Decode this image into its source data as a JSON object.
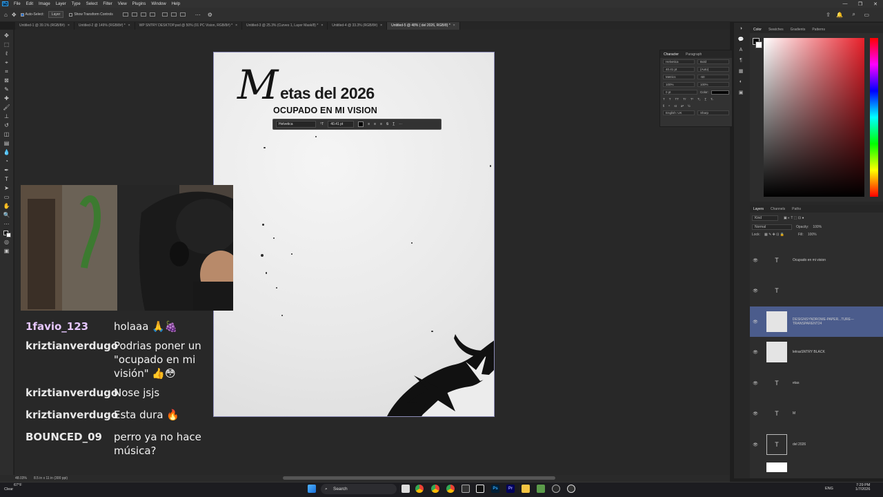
{
  "menubar": {
    "items": [
      "File",
      "Edit",
      "Image",
      "Layer",
      "Type",
      "Select",
      "Filter",
      "View",
      "Plugins",
      "Window",
      "Help"
    ]
  },
  "options_bar": {
    "auto_select_label": "Auto-Select:",
    "auto_select_value": "Layer",
    "show_transform_label": "Show Transform Controls"
  },
  "tabs": [
    {
      "label": "Untitled-1 @ 39.1% (RGB/8#)"
    },
    {
      "label": "Untitled-2 @ 149% (RGB/8#) *"
    },
    {
      "label": "WP SNTRY DESKTOP.psd @ 50% (01 PC Vision, RGB/8#) *"
    },
    {
      "label": "Untitled-3 @ 25.3% (Curves 1, Layer Mask/8) *"
    },
    {
      "label": "Untitled-4 @ 33.3% (RGB/8#)"
    },
    {
      "label": "Untitled-5 @ 48% ( del 2026, RGB/8) *"
    }
  ],
  "document": {
    "title_script": "M",
    "title_rest": "etas del 2026",
    "subtitle": "OCUPADO EN MI VISION"
  },
  "context_bar": {
    "font": "Helvetica",
    "size": "40.41 pt"
  },
  "character_panel": {
    "tabs": [
      "Character",
      "Paragraph"
    ],
    "font_family": "Helvetica",
    "font_style": "Bold",
    "size": "40.41 pt",
    "leading": "(Auto)",
    "kerning": "Metrics",
    "tracking": "-60",
    "vscale": "100%",
    "hscale": "100%",
    "baseline": "0 pt",
    "color_label": "Color:",
    "language": "English: UK",
    "aa": "Sharp"
  },
  "color_panel": {
    "tabs": [
      "Color",
      "Swatches",
      "Gradients",
      "Patterns"
    ]
  },
  "layers_panel": {
    "tabs": [
      "Layers",
      "Channels",
      "Paths"
    ],
    "kind": "Kind",
    "blend": "Normal",
    "opacity_label": "Opacity:",
    "opacity": "100%",
    "lock_label": "Lock:",
    "fill_label": "Fill:",
    "fill": "100%",
    "layers": [
      {
        "name": "Ocupado en mi vision",
        "type": "text"
      },
      {
        "name": "",
        "type": "text"
      },
      {
        "name": "DESIGNSYNDROME-PAPER...TURE---TRANSPARENT24",
        "type": "image",
        "selected": true
      },
      {
        "name": "letrasSNTRY BLACK",
        "type": "image"
      },
      {
        "name": "etas",
        "type": "text"
      },
      {
        "name": "M",
        "type": "text"
      },
      {
        "name": "del 2026",
        "type": "text"
      }
    ]
  },
  "chat": [
    {
      "user": "1favio_123",
      "message": "holaaa 🙏🍇"
    },
    {
      "user": "kriztianverdugo",
      "message": "Podrias poner un \"ocupado en mi visión\" 👍😳"
    },
    {
      "user": "kriztianverdugo",
      "message": "Nose jsjs"
    },
    {
      "user": "kriztianverdugo",
      "message": "Esta dura 🔥"
    },
    {
      "user": "BOUNCED_09",
      "message": "perro ya no hace música?"
    }
  ],
  "statusbar": {
    "zoom": "48.03%",
    "doc_size": "8.5 in x 11 in (300 ppi)"
  },
  "taskbar": {
    "temp": "67°F",
    "weather": "Clear",
    "search": "Search",
    "lang": "ENG",
    "time": "7:29 PM",
    "date": "1/7/2026"
  }
}
